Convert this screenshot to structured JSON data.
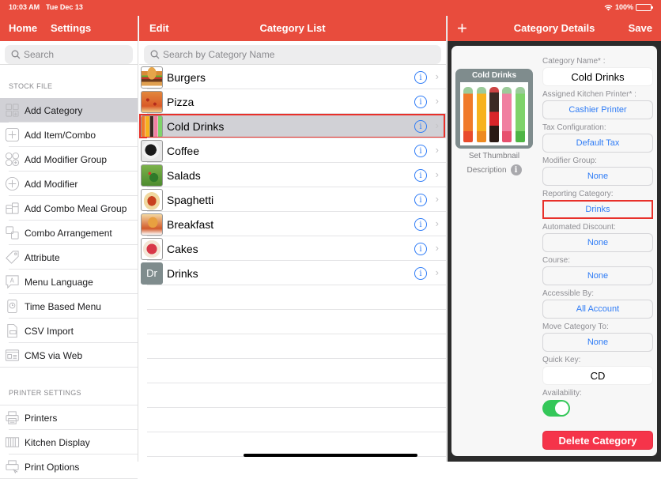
{
  "status_bar": {
    "time": "10:03 AM",
    "date": "Tue Dec 13",
    "battery": "100%"
  },
  "sidebar": {
    "nav": {
      "home": "Home",
      "title": "Settings"
    },
    "search_placeholder": "Search",
    "sections": [
      {
        "header": "STOCK FILE",
        "items": [
          {
            "label": "Add Category",
            "icon": "add-category-icon",
            "active": true
          },
          {
            "label": "Add Item/Combo",
            "icon": "add-item-icon"
          },
          {
            "label": "Add Modifier Group",
            "icon": "add-modifier-group-icon"
          },
          {
            "label": "Add Modifier",
            "icon": "add-modifier-icon"
          },
          {
            "label": "Add Combo Meal Group",
            "icon": "combo-meal-icon"
          },
          {
            "label": "Combo Arrangement",
            "icon": "combo-arrangement-icon"
          },
          {
            "label": "Attribute",
            "icon": "tag-icon"
          },
          {
            "label": "Menu Language",
            "icon": "language-icon"
          },
          {
            "label": "Time Based Menu",
            "icon": "clock-icon"
          },
          {
            "label": "CSV Import",
            "icon": "csv-icon"
          },
          {
            "label": "CMS via Web",
            "icon": "web-icon"
          }
        ]
      },
      {
        "header": "PRINTER SETTINGS",
        "items": [
          {
            "label": "Printers",
            "icon": "printer-icon"
          },
          {
            "label": "Kitchen Display",
            "icon": "kitchen-display-icon"
          },
          {
            "label": "Print Options",
            "icon": "print-options-icon"
          }
        ]
      }
    ]
  },
  "category_list": {
    "nav": {
      "edit": "Edit",
      "title": "Category List"
    },
    "search_placeholder": "Search by Category Name",
    "items": [
      {
        "name": "Burgers",
        "thumb": "burger"
      },
      {
        "name": "Pizza",
        "thumb": "pizza"
      },
      {
        "name": "Cold Drinks",
        "thumb": "drinks",
        "selected": true
      },
      {
        "name": "Coffee",
        "thumb": "coffee"
      },
      {
        "name": "Salads",
        "thumb": "salad"
      },
      {
        "name": "Spaghetti",
        "thumb": "spaghetti"
      },
      {
        "name": "Breakfast",
        "thumb": "breakfast"
      },
      {
        "name": "Cakes",
        "thumb": "cake"
      },
      {
        "name": "Drinks",
        "thumb": "initials",
        "initials": "Dr"
      }
    ]
  },
  "details": {
    "nav": {
      "add": "+",
      "title": "Category Details",
      "save": "Save"
    },
    "thumbnail_title": "Cold Drinks",
    "set_thumbnail": "Set Thumbnail",
    "description": "Description",
    "fields": [
      {
        "label": "Category Name* :",
        "value": "Cold Drinks",
        "type": "text"
      },
      {
        "label": "Assigned Kitchen Printer* :",
        "value": "Cashier Printer",
        "type": "select"
      },
      {
        "label": "Tax Configuration:",
        "value": "Default Tax",
        "type": "select"
      },
      {
        "label": "Modifier Group:",
        "value": "None",
        "type": "select"
      },
      {
        "label": "Reporting Category:",
        "value": "Drinks",
        "type": "select",
        "highlighted": true
      },
      {
        "label": "Automated Discount:",
        "value": "None",
        "type": "select"
      },
      {
        "label": "Course:",
        "value": "None",
        "type": "select"
      },
      {
        "label": "Accessible By:",
        "value": "All Account",
        "type": "select"
      },
      {
        "label": "Move Category To:",
        "value": "None",
        "type": "select"
      },
      {
        "label": "Quick Key:",
        "value": "CD",
        "type": "text"
      }
    ],
    "availability": {
      "label": "Availability:",
      "on": true
    },
    "delete_label": "Delete Category"
  },
  "colors": {
    "brand": "#e84c3d",
    "link": "#2f7cf6",
    "highlight": "#e8302a",
    "toggle_on": "#34c759",
    "delete": "#f5344a"
  }
}
